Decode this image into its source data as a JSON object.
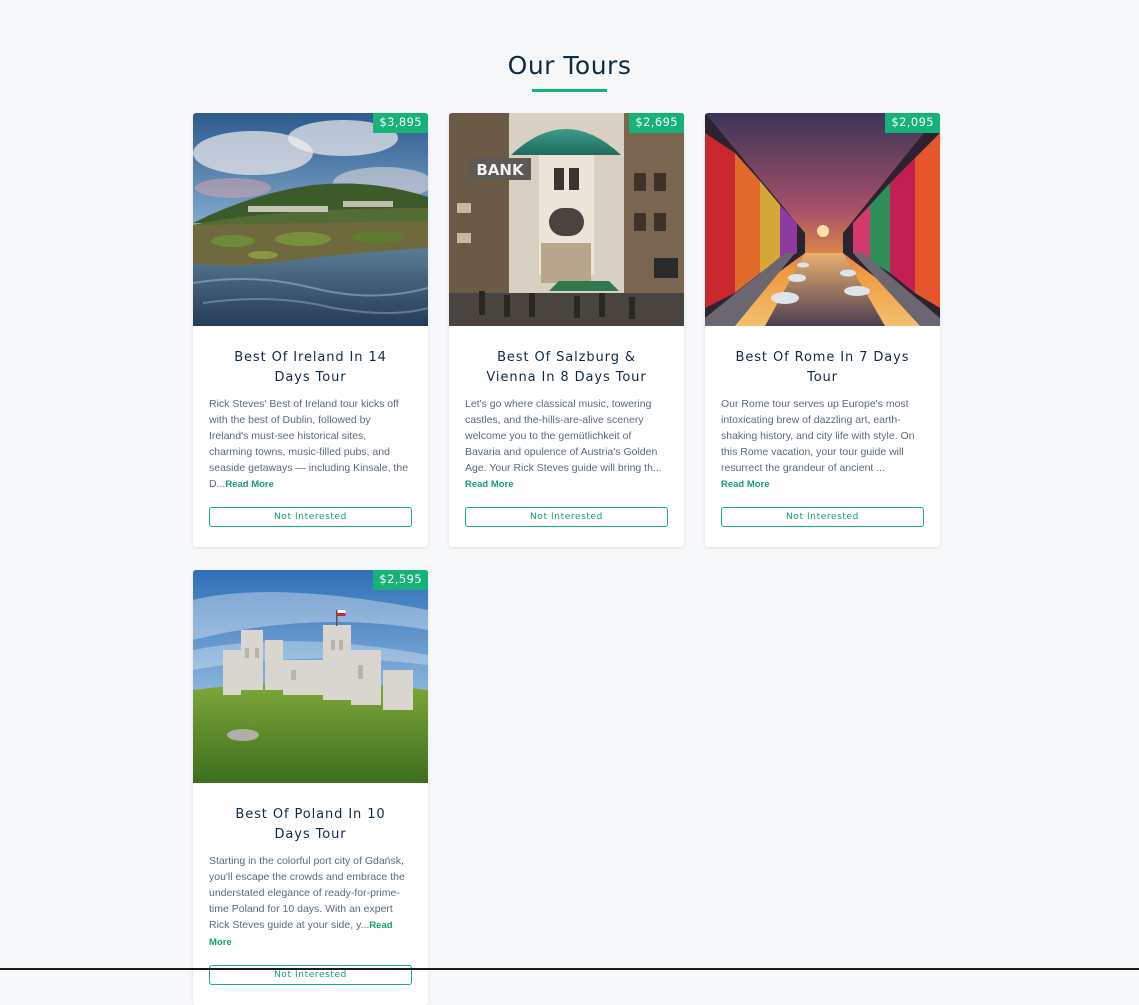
{
  "page": {
    "title": "Our Tours"
  },
  "tours": [
    {
      "price": "$3,895",
      "title": "Best Of Ireland In 14 Days Tour",
      "description": "Rick Steves' Best of Ireland tour kicks off with the best of Dublin, followed by Ireland's must-see historical sites, charming towns, music-filled pubs, and seaside getaways — including Kinsale, the D...",
      "read_more": "Read More",
      "button": "Not Interested"
    },
    {
      "price": "$2,695",
      "title": "Best Of Salzburg & Vienna In 8 Days Tour",
      "description": "Let's go where classical music, towering castles, and the-hills-are-alive scenery welcome you to the gemütlichkeit of Bavaria and opulence of Austria's Golden Age. Your Rick Steves guide will bring th...",
      "read_more": "Read More",
      "button": "Not Interested"
    },
    {
      "price": "$2,095",
      "title": "Best Of Rome In 7 Days Tour",
      "description": "Our Rome tour serves up Europe's most intoxicating brew of dazzling art, earth-shaking history, and city life with style. On this Rome vacation, your tour guide will resurrect the grandeur of ancient ...",
      "read_more": "Read More",
      "button": "Not Interested"
    },
    {
      "price": "$2,595",
      "title": "Best Of Poland In 10 Days Tour",
      "description": "Starting in the colorful port city of Gdańsk, you'll escape the crowds and embrace the understated elegance of ready-for-prime-time Poland for 10 days. With an expert Rick Steves guide at your side, y...",
      "read_more": "Read More",
      "button": "Not Interested"
    }
  ],
  "colors": {
    "accent": "#16b27a",
    "background": "#f7f8fa",
    "text": "#102a43"
  }
}
